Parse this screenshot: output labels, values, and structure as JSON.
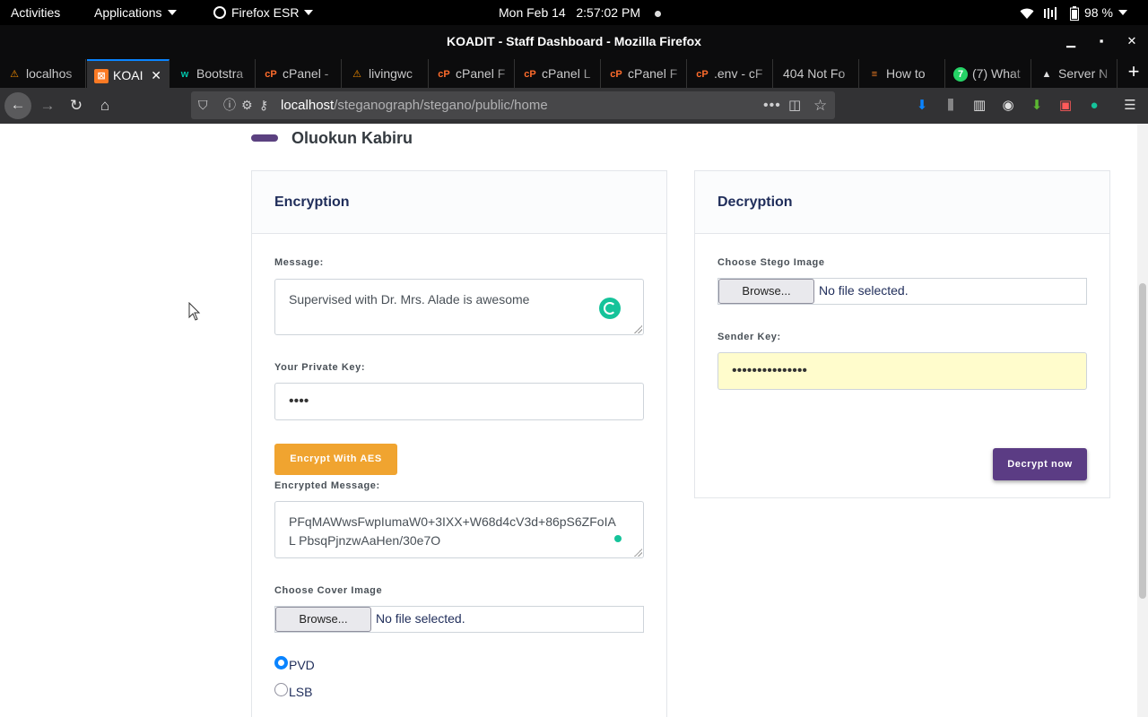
{
  "system_bar": {
    "activities": "Activities",
    "applications": "Applications",
    "firefox_menu": "Firefox ESR",
    "clock": "Mon Feb 14   2:57:02 PM",
    "battery": "98 %"
  },
  "window": {
    "title": "KOADIT - Staff Dashboard - Mozilla Firefox"
  },
  "tabs": [
    {
      "label": "localhos",
      "icon": "xampp-icon",
      "color": "#f28c00"
    },
    {
      "label": "KOAI",
      "icon": "xampp-icon",
      "color": "#fb7a24",
      "active": true
    },
    {
      "label": "Bootstra",
      "icon": "w-icon",
      "color": "#00c2a8"
    },
    {
      "label": "cPanel -",
      "icon": "cpanel-icon",
      "color": "#ff6c2c"
    },
    {
      "label": "livingwc",
      "icon": "xampp-icon",
      "color": "#f28c00"
    },
    {
      "label": "cPanel F",
      "icon": "cpanel-icon",
      "color": "#ff6c2c"
    },
    {
      "label": "cPanel L",
      "icon": "cpanel-icon",
      "color": "#ff6c2c"
    },
    {
      "label": "cPanel F",
      "icon": "cpanel-icon",
      "color": "#ff6c2c"
    },
    {
      "label": ".env - cF",
      "icon": "cpanel-icon",
      "color": "#ff6c2c"
    },
    {
      "label": "404 Not Fo",
      "icon": "",
      "color": ""
    },
    {
      "label": "How to",
      "icon": "stackoverflow-icon",
      "color": "#f48024"
    },
    {
      "label": "(7) What",
      "icon": "whatsapp-icon",
      "color": "#25d366"
    },
    {
      "label": "Server N",
      "icon": "warning-icon",
      "color": "#e0e0e0"
    }
  ],
  "nav": {
    "url_host": "localhost",
    "url_path": "/steganograph/stegano/public/home"
  },
  "page": {
    "user_name": "Oluokun Kabiru",
    "encryption": {
      "title": "Encryption",
      "message_label": "Message:",
      "message_value": "Supervised with Dr. Mrs. Alade is awesome",
      "private_key_label": "Your Private Key:",
      "private_key_value": "••••",
      "encrypt_button": "Encrypt With AES",
      "encrypted_label": "Encrypted Message:",
      "encrypted_value": "PFqMAWwsFwpIumaW0+3IXX+W68d4cV3d+86pS6ZFoIAL PbsqPjnzwAaHen/30e7O",
      "cover_label": "Choose Cover Image",
      "browse_label": "Browse...",
      "no_file": "No file selected.",
      "radio_pvd": "PVD",
      "radio_lsb": "LSB"
    },
    "decryption": {
      "title": "Decryption",
      "stego_label": "Choose Stego Image",
      "browse_label": "Browse...",
      "no_file": "No file selected.",
      "sender_key_label": "Sender Key:",
      "sender_key_value": "•••••••••••••••",
      "decrypt_button": "Decrypt now"
    }
  },
  "colors": {
    "accent_purple": "#5b3c84",
    "accent_orange": "#f0a430",
    "heading_navy": "#1f2d5a"
  }
}
